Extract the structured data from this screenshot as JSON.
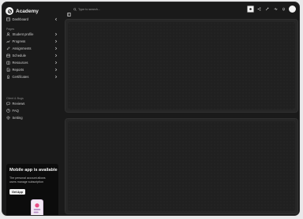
{
  "brand": {
    "name": "Academy"
  },
  "sidebar": {
    "top_item": {
      "label": "Dashboard"
    },
    "pages_label": "Pages",
    "pages": [
      {
        "label": "Student profile",
        "icon": "person-icon"
      },
      {
        "label": "Progress",
        "icon": "chart-icon"
      },
      {
        "label": "Assignments",
        "icon": "pencil-icon"
      },
      {
        "label": "Schedule",
        "icon": "calendar-icon"
      },
      {
        "label": "Resources",
        "icon": "book-icon"
      },
      {
        "label": "Reports",
        "icon": "document-icon"
      },
      {
        "label": "Certificates",
        "icon": "certificate-icon"
      }
    ],
    "client_label": "Client & Bugs",
    "client_items": [
      {
        "label": "Reviews",
        "icon": "chat-icon"
      },
      {
        "label": "FAQ",
        "icon": "question-icon"
      },
      {
        "label": "Setting",
        "icon": "gear-icon"
      }
    ]
  },
  "promo": {
    "title": "Mobile app is available",
    "description": "The personal account allows users manage subscription",
    "button_label": "Get App"
  },
  "topbar": {
    "search_placeholder": "Type to search..."
  },
  "colors": {
    "background": "#1a1a1a",
    "card": "#262626",
    "accent": "#f2f2f2"
  }
}
